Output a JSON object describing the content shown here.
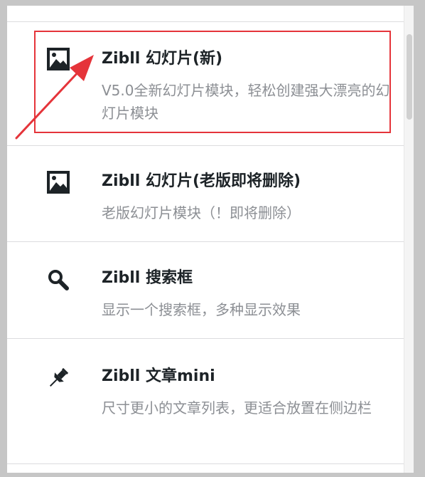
{
  "list": {
    "items": [
      {
        "title": "Zibll 幻灯片(新)",
        "description": "V5.0全新幻灯片模块，轻松创建强大漂亮的幻灯片模块",
        "icon": "image-icon"
      },
      {
        "title": "Zibll 幻灯片(老版即将删除)",
        "description": "老版幻灯片模块（！即将删除）",
        "icon": "image-icon"
      },
      {
        "title": "Zibll 搜索框",
        "description": "显示一个搜索框，多种显示效果",
        "icon": "search-icon"
      },
      {
        "title": "Zibll 文章mini",
        "description": "尺寸更小的文章列表，更适合放置在侧边栏",
        "icon": "pin-icon"
      }
    ]
  },
  "annotation": {
    "highlight_color": "#e5343a",
    "arrow_color": "#e5343a"
  },
  "colors": {
    "title": "#1d2327",
    "description": "#8c8f94",
    "divider": "#dcdcde",
    "background": "#c6c6c6"
  }
}
